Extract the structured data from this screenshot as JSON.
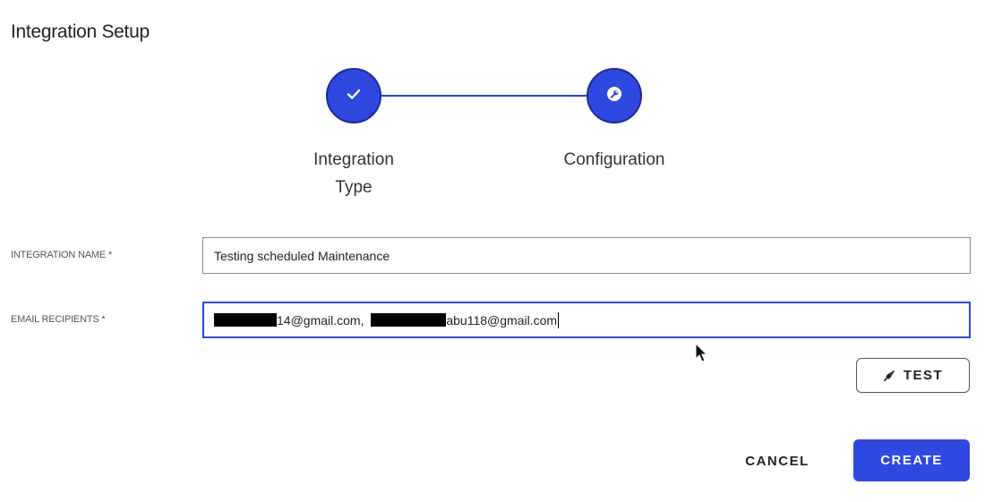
{
  "page": {
    "title": "Integration Setup"
  },
  "stepper": {
    "steps": [
      {
        "label": "Integration Type",
        "icon": "check-icon",
        "state": "completed"
      },
      {
        "label": "Configuration",
        "icon": "wrench-icon",
        "state": "active"
      }
    ]
  },
  "form": {
    "integration_name": {
      "label": "INTEGRATION NAME *",
      "value": "Testing scheduled Maintenance"
    },
    "email_recipients": {
      "label": "EMAIL RECIPIENTS *",
      "value_part1": "14@gmail.com, ",
      "value_part2": "abu118@gmail.com"
    }
  },
  "actions": {
    "test_label": "TEST",
    "test_icon": "plug-icon",
    "cancel_label": "CANCEL",
    "create_label": "CREATE"
  },
  "colors": {
    "primary": "#2f49e0",
    "focus_border": "#3148d6"
  }
}
